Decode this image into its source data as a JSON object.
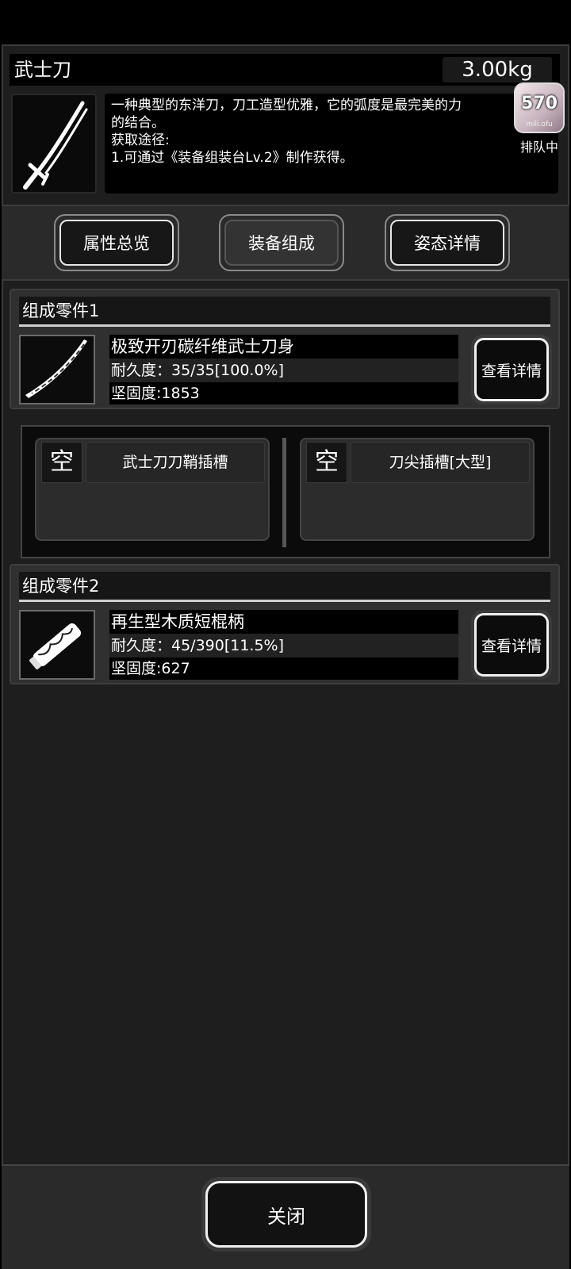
{
  "item": {
    "title": "武士刀",
    "weight": "3.00kg",
    "description_lines": [
      "一种典型的东洋刀，刀工造型优雅，它的弧度是最完美的力",
      "的结合。",
      "获取途径:",
      "1.可通过《装备组装台Lv.2》制作获得。"
    ],
    "icon": "katana-icon"
  },
  "queue": {
    "number": "570",
    "sub": "mili.ofu",
    "label": "排队中"
  },
  "tabs": [
    {
      "label": "属性总览",
      "active": false
    },
    {
      "label": "装备组成",
      "active": true
    },
    {
      "label": "姿态详情",
      "active": false
    }
  ],
  "components": [
    {
      "header": "组成零件1",
      "name": "极致开刃碳纤维武士刀身",
      "durability": "耐久度：35/35[100.0%]",
      "hardness": "坚固度:1853",
      "detail_label": "查看详情",
      "icon": "blade-icon"
    },
    {
      "header": "组成零件2",
      "name": "再生型木质短棍柄",
      "durability": "耐久度：45/390[11.5%]",
      "hardness": "坚固度:627",
      "detail_label": "查看详情",
      "icon": "handle-icon"
    }
  ],
  "slots": [
    {
      "status": "空",
      "name": "武士刀刀鞘插槽"
    },
    {
      "status": "空",
      "name": "刀尖插槽[大型]"
    }
  ],
  "close_label": "关闭"
}
